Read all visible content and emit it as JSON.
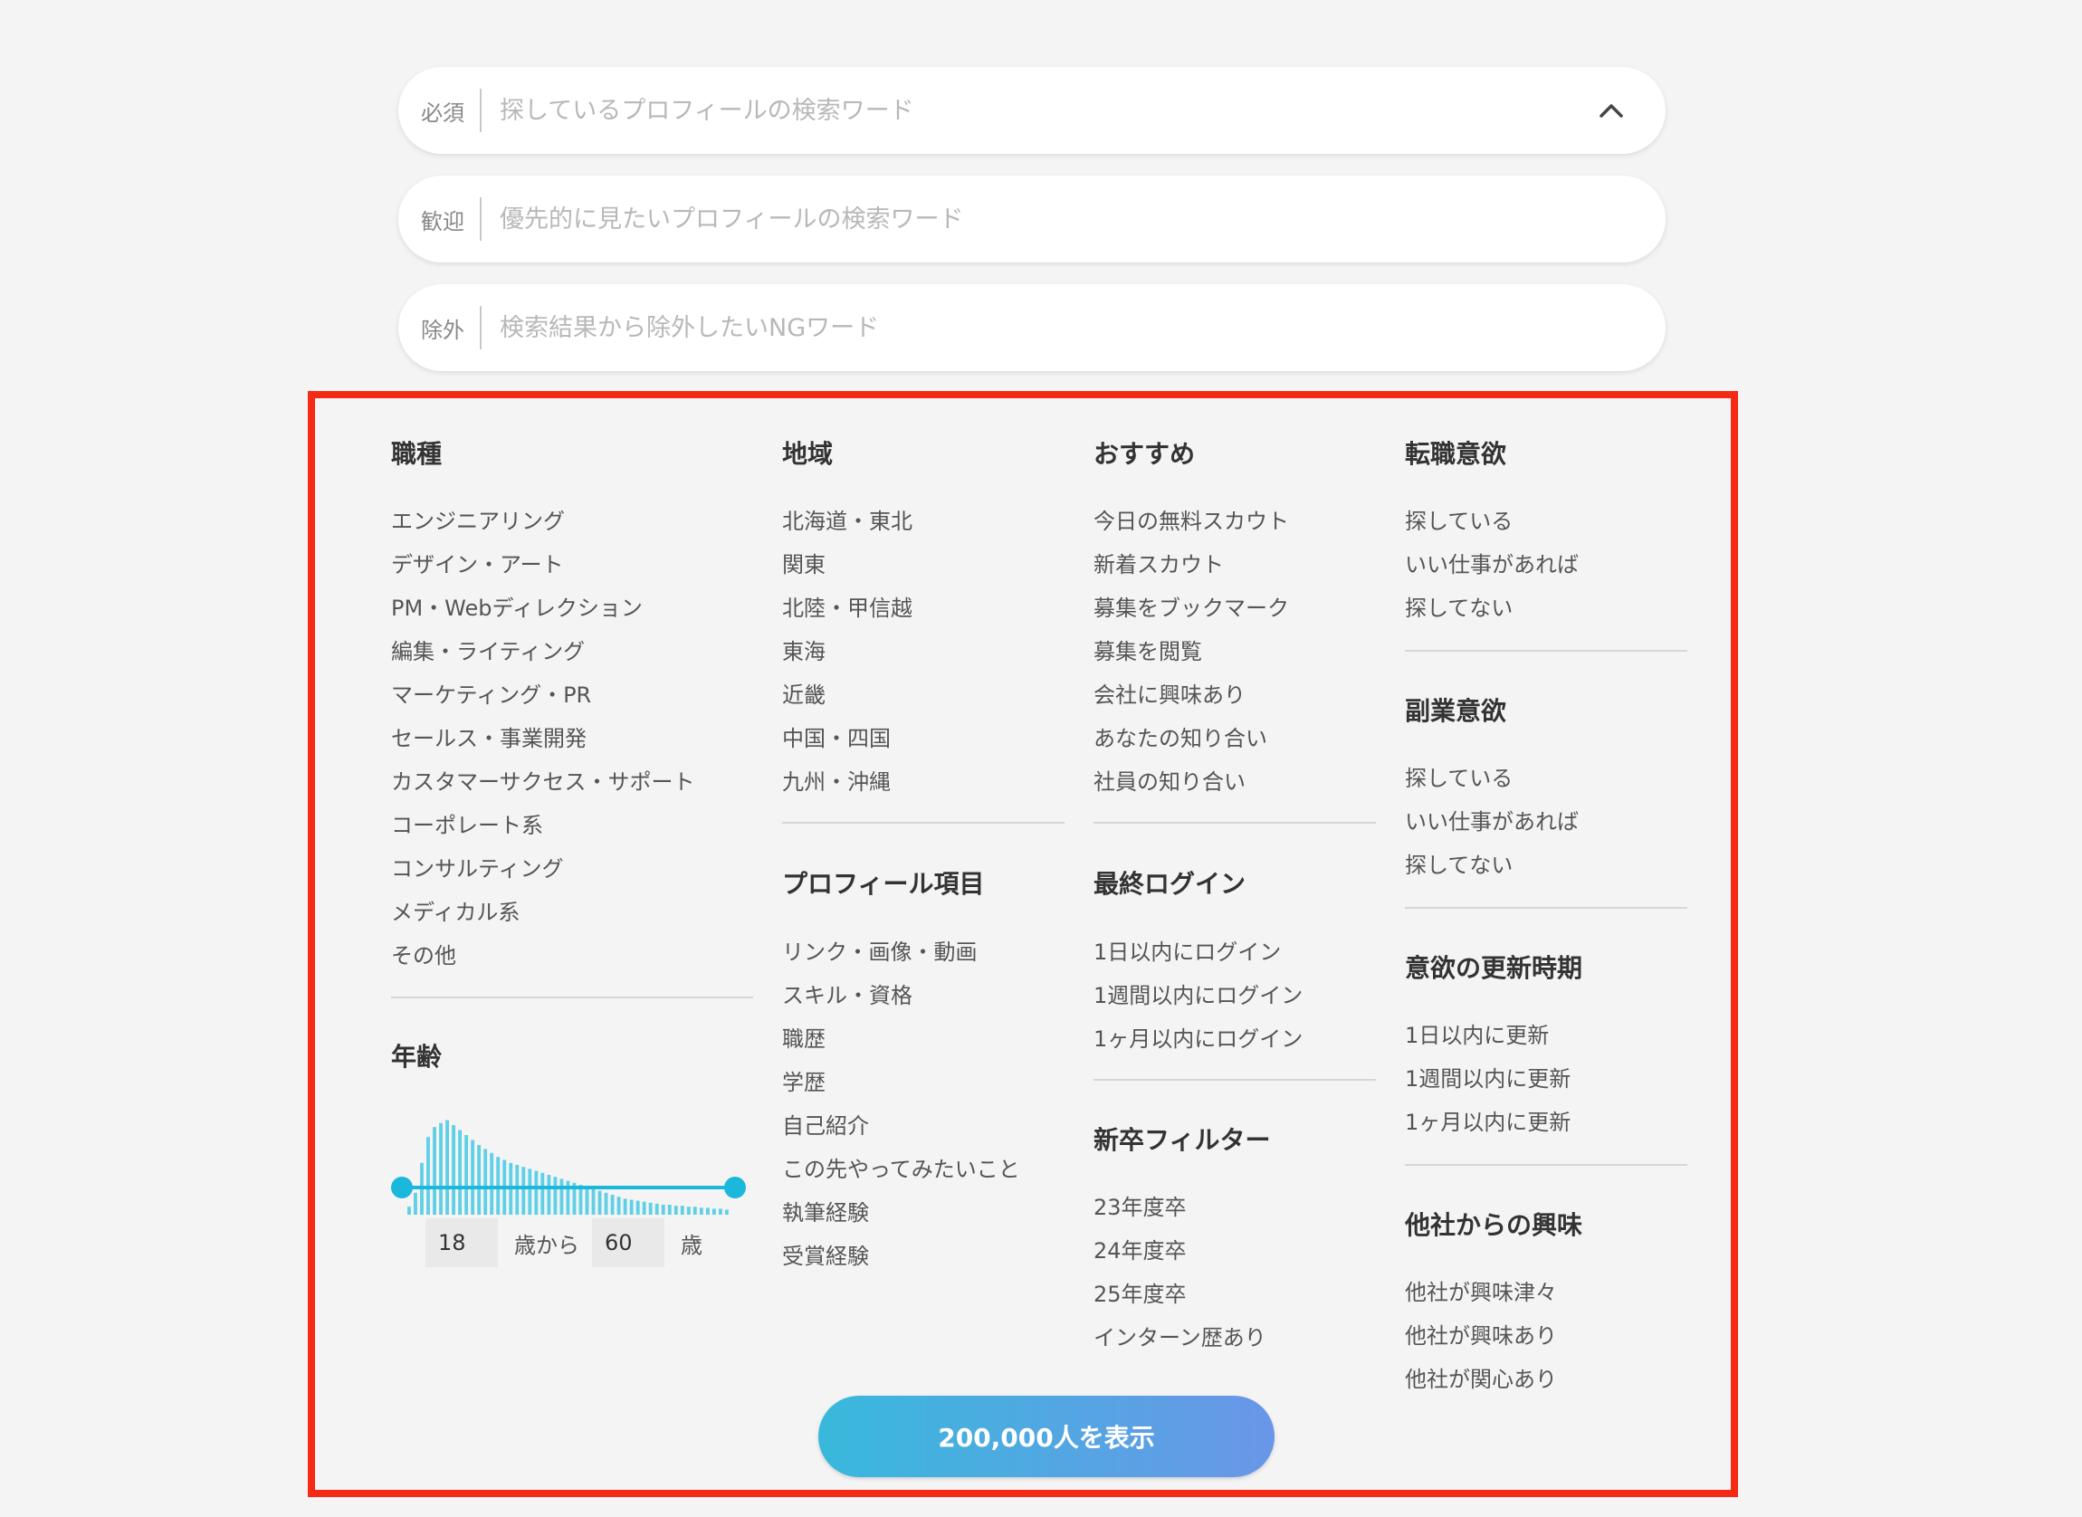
{
  "search": {
    "required": {
      "tag": "必須",
      "placeholder": "探しているプロフィールの検索ワード"
    },
    "welcome": {
      "tag": "歓迎",
      "placeholder": "優先的に見たいプロフィールの検索ワード"
    },
    "exclude": {
      "tag": "除外",
      "placeholder": "検索結果から除外したいNGワード"
    }
  },
  "filters": {
    "job_type": {
      "title": "職種",
      "options": [
        "エンジニアリング",
        "デザイン・アート",
        "PM・Webディレクション",
        "編集・ライティング",
        "マーケティング・PR",
        "セールス・事業開発",
        "カスタマーサクセス・サポート",
        "コーポレート系",
        "コンサルティング",
        "メディカル系",
        "その他"
      ]
    },
    "age": {
      "title": "年齢",
      "min": "18",
      "from_label": "歳から",
      "max": "60",
      "to_label": "歳"
    },
    "region": {
      "title": "地域",
      "options": [
        "北海道・東北",
        "関東",
        "北陸・甲信越",
        "東海",
        "近畿",
        "中国・四国",
        "九州・沖縄"
      ]
    },
    "profile_items": {
      "title": "プロフィール項目",
      "options": [
        "リンク・画像・動画",
        "スキル・資格",
        "職歴",
        "学歴",
        "自己紹介",
        "この先やってみたいこと",
        "執筆経験",
        "受賞経験"
      ]
    },
    "recommended": {
      "title": "おすすめ",
      "options": [
        "今日の無料スカウト",
        "新着スカウト",
        "募集をブックマーク",
        "募集を閲覧",
        "会社に興味あり",
        "あなたの知り合い",
        "社員の知り合い"
      ]
    },
    "last_login": {
      "title": "最終ログイン",
      "options": [
        "1日以内にログイン",
        "1週間以内にログイン",
        "1ヶ月以内にログイン"
      ]
    },
    "new_grad": {
      "title": "新卒フィルター",
      "options": [
        "23年度卒",
        "24年度卒",
        "25年度卒",
        "インターン歴あり"
      ]
    },
    "job_change": {
      "title": "転職意欲",
      "options": [
        "探している",
        "いい仕事があれば",
        "探してない"
      ]
    },
    "side_job": {
      "title": "副業意欲",
      "options": [
        "探している",
        "いい仕事があれば",
        "探してない"
      ]
    },
    "motivation_update": {
      "title": "意欲の更新時期",
      "options": [
        "1日以内に更新",
        "1週間以内に更新",
        "1ヶ月以内に更新"
      ]
    },
    "other_interest": {
      "title": "他社からの興味",
      "options": [
        "他社が興味津々",
        "他社が興味あり",
        "他社が関心あり"
      ]
    }
  },
  "cta": {
    "label": "200,000人を表示"
  },
  "colors": {
    "accent": "#1cb8dc",
    "highlight_border": "#f42a14",
    "button_start": "#38b9dc",
    "button_end": "#6a96e8"
  },
  "age_histogram": [
    0.08,
    0.22,
    0.52,
    0.78,
    0.88,
    0.92,
    0.95,
    0.9,
    0.85,
    0.8,
    0.75,
    0.7,
    0.66,
    0.62,
    0.58,
    0.55,
    0.52,
    0.5,
    0.48,
    0.46,
    0.44,
    0.42,
    0.4,
    0.38,
    0.36,
    0.34,
    0.32,
    0.3,
    0.28,
    0.26,
    0.24,
    0.22,
    0.2,
    0.18,
    0.16,
    0.15,
    0.14,
    0.13,
    0.12,
    0.11,
    0.1,
    0.1,
    0.09,
    0.09,
    0.08,
    0.08,
    0.07,
    0.07,
    0.06,
    0.06,
    0.05
  ]
}
